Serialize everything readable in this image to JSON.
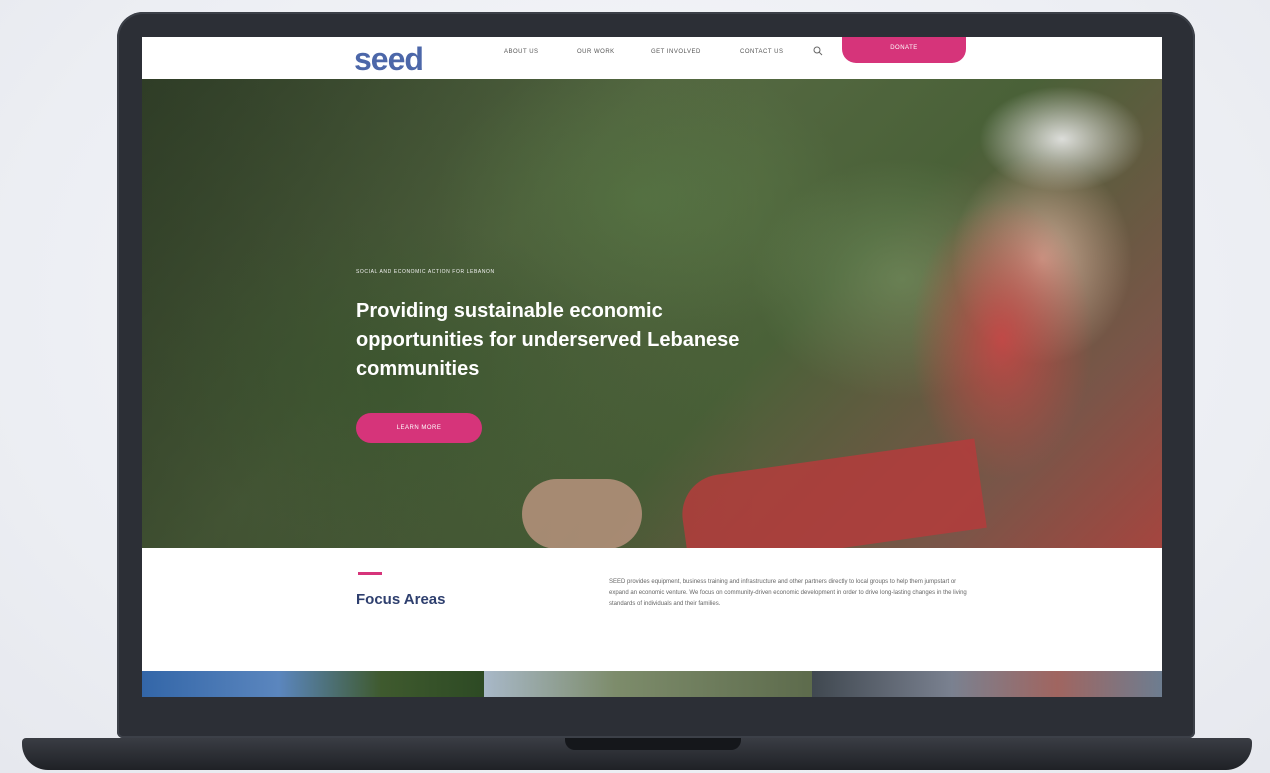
{
  "nav": {
    "logo": "seed",
    "links": [
      "ABOUT US",
      "OUR WORK",
      "GET INVOLVED",
      "CONTACT US"
    ],
    "donate_label": "DONATE",
    "search_icon": "search-icon"
  },
  "hero": {
    "eyebrow": "SOCIAL AND ECONOMIC ACTION FOR LEBANON",
    "headline": "Providing sustainable economic opportunities for underserved Lebanese communities",
    "cta_label": "LEARN MORE"
  },
  "focus": {
    "title": "Focus Areas",
    "body": "SEED provides equipment, business training and infrastructure and other partners directly to local groups to help them jumpstart or expand an economic venture. We focus on community-driven economic development in order to drive long-lasting changes in the living standards of individuals and their families."
  },
  "colors": {
    "accent": "#d6347a",
    "brand": "#4c67a9",
    "heading": "#2e3f6e"
  }
}
